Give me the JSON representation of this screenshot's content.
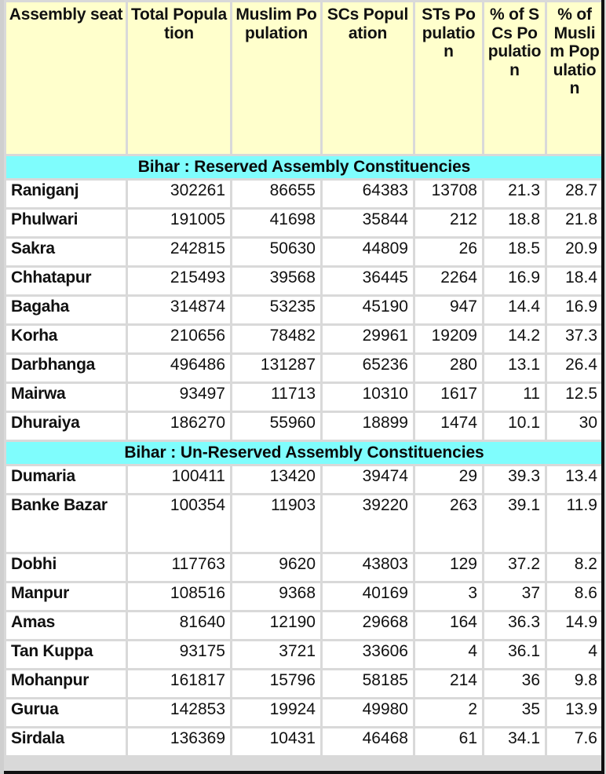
{
  "table": {
    "columns": [
      {
        "key": "seat",
        "label": "Assembly seat"
      },
      {
        "key": "total",
        "label": "Total Population"
      },
      {
        "key": "muslim",
        "label": "Muslim Population"
      },
      {
        "key": "scs",
        "label": "SCs Population"
      },
      {
        "key": "sts",
        "label": "STs Population"
      },
      {
        "key": "pscs",
        "label": "% of SCs Population"
      },
      {
        "key": "pmus",
        "label": "% of Muslim Population"
      }
    ],
    "sections": [
      {
        "title": "Bihar : Reserved Assembly Constituencies",
        "rows": [
          {
            "seat": "Raniganj",
            "total": "302261",
            "muslim": "86655",
            "scs": "64383",
            "sts": "13708",
            "pscs": "21.3",
            "pmus": "28.7"
          },
          {
            "seat": "Phulwari",
            "total": "191005",
            "muslim": "41698",
            "scs": "35844",
            "sts": "212",
            "pscs": "18.8",
            "pmus": "21.8"
          },
          {
            "seat": "Sakra",
            "total": "242815",
            "muslim": "50630",
            "scs": "44809",
            "sts": "26",
            "pscs": "18.5",
            "pmus": "20.9"
          },
          {
            "seat": "Chhatapur",
            "total": "215493",
            "muslim": "39568",
            "scs": "36445",
            "sts": "2264",
            "pscs": "16.9",
            "pmus": "18.4"
          },
          {
            "seat": "Bagaha",
            "total": "314874",
            "muslim": "53235",
            "scs": "45190",
            "sts": "947",
            "pscs": "14.4",
            "pmus": "16.9"
          },
          {
            "seat": "Korha",
            "total": "210656",
            "muslim": "78482",
            "scs": "29961",
            "sts": "19209",
            "pscs": "14.2",
            "pmus": "37.3"
          },
          {
            "seat": "Darbhanga",
            "total": "496486",
            "muslim": "131287",
            "scs": "65236",
            "sts": "280",
            "pscs": "13.1",
            "pmus": "26.4"
          },
          {
            "seat": "Mairwa",
            "total": "93497",
            "muslim": "11713",
            "scs": "10310",
            "sts": "1617",
            "pscs": "11",
            "pmus": "12.5"
          },
          {
            "seat": "Dhuraiya",
            "total": "186270",
            "muslim": "55960",
            "scs": "18899",
            "sts": "1474",
            "pscs": "10.1",
            "pmus": "30"
          }
        ]
      },
      {
        "title": "Bihar : Un-Reserved Assembly Constituencies",
        "rows": [
          {
            "seat": "Dumaria",
            "total": "100411",
            "muslim": "13420",
            "scs": "39474",
            "sts": "29",
            "pscs": "39.3",
            "pmus": "13.4"
          },
          {
            "seat": "Banke Bazar",
            "total": "100354",
            "muslim": "11903",
            "scs": "39220",
            "sts": "263",
            "pscs": "39.1",
            "pmus": "11.9",
            "tall": true
          },
          {
            "seat": "Dobhi",
            "total": "117763",
            "muslim": "9620",
            "scs": "43803",
            "sts": "129",
            "pscs": "37.2",
            "pmus": "8.2"
          },
          {
            "seat": "Manpur",
            "total": "108516",
            "muslim": "9368",
            "scs": "40169",
            "sts": "3",
            "pscs": "37",
            "pmus": "8.6"
          },
          {
            "seat": "Amas",
            "total": "81640",
            "muslim": "12190",
            "scs": "29668",
            "sts": "164",
            "pscs": "36.3",
            "pmus": "14.9"
          },
          {
            "seat": "Tan Kuppa",
            "total": "93175",
            "muslim": "3721",
            "scs": "33606",
            "sts": "4",
            "pscs": "36.1",
            "pmus": "4"
          },
          {
            "seat": "Mohanpur",
            "total": "161817",
            "muslim": "15796",
            "scs": "58185",
            "sts": "214",
            "pscs": "36",
            "pmus": "9.8"
          },
          {
            "seat": "Gurua",
            "total": "142853",
            "muslim": "19924",
            "scs": "49980",
            "sts": "2",
            "pscs": "35",
            "pmus": "13.9"
          },
          {
            "seat": "Sirdala",
            "total": "136369",
            "muslim": "10431",
            "scs": "46468",
            "sts": "61",
            "pscs": "34.1",
            "pmus": "7.6"
          }
        ]
      }
    ]
  },
  "colors": {
    "header_background": "#FFFFCC",
    "section_background": "#7FFDFD",
    "cell_background": "#FFFFFF",
    "grid_background": "#D9D9D9",
    "text": "#111111"
  }
}
